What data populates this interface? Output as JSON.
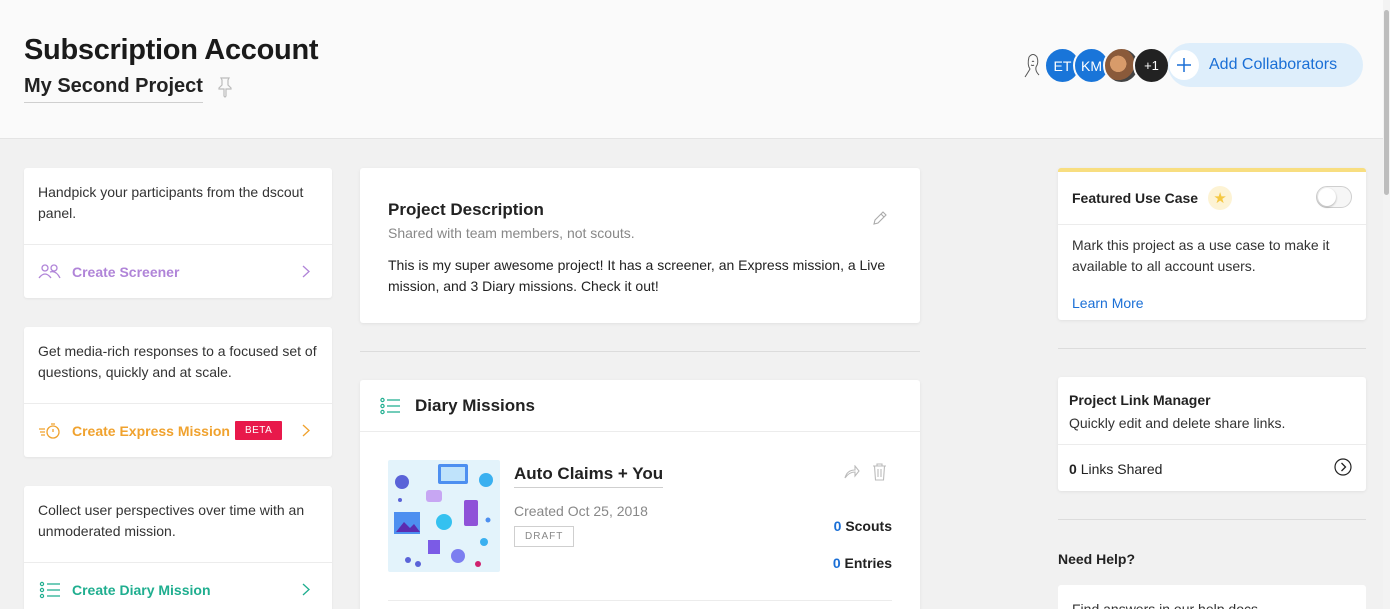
{
  "header": {
    "account_title": "Subscription Account",
    "project_title": "My Second Project",
    "collaborators": {
      "avatars": [
        "ET",
        "KM"
      ],
      "more_count": "+1",
      "add_label": "Add Collaborators"
    }
  },
  "left_cards": [
    {
      "description": "Handpick your participants from the dscout panel.",
      "action_label": "Create Screener",
      "color": "#b084d8"
    },
    {
      "description": "Get media-rich responses to a focused set of questions, quickly and at scale.",
      "action_label": "Create Express Mission",
      "badge": "BETA",
      "color": "#f0a22e"
    },
    {
      "description": "Collect user perspectives over time with an unmoderated mission.",
      "action_label": "Create Diary Mission",
      "color": "#1fae8f"
    }
  ],
  "project_description": {
    "title": "Project Description",
    "subtitle": "Shared with team members, not scouts.",
    "body": "This is my super awesome project! It has a screener, an Express mission, a Live mission, and 3 Diary missions. Check it out!"
  },
  "diary_missions": {
    "title": "Diary Missions",
    "missions": [
      {
        "name": "Auto Claims + You",
        "created": "Created Oct 25, 2018",
        "status": "DRAFT",
        "scouts_count": "0",
        "scouts_label": "Scouts",
        "entries_count": "0",
        "entries_label": "Entries"
      }
    ]
  },
  "featured_use_case": {
    "title": "Featured Use Case",
    "body": "Mark this project as a use case to make it available to all account users.",
    "link": "Learn More",
    "enabled": false
  },
  "project_link_manager": {
    "title": "Project Link Manager",
    "subtitle": "Quickly edit and delete share links.",
    "links_count": "0",
    "links_label": "Links Shared"
  },
  "help": {
    "title": "Need Help?",
    "text": "Find answers in our help docs"
  },
  "colors": {
    "accent_blue": "#1a6fd6",
    "beta_red": "#e8194b",
    "featured_yellow": "#f8de80"
  }
}
